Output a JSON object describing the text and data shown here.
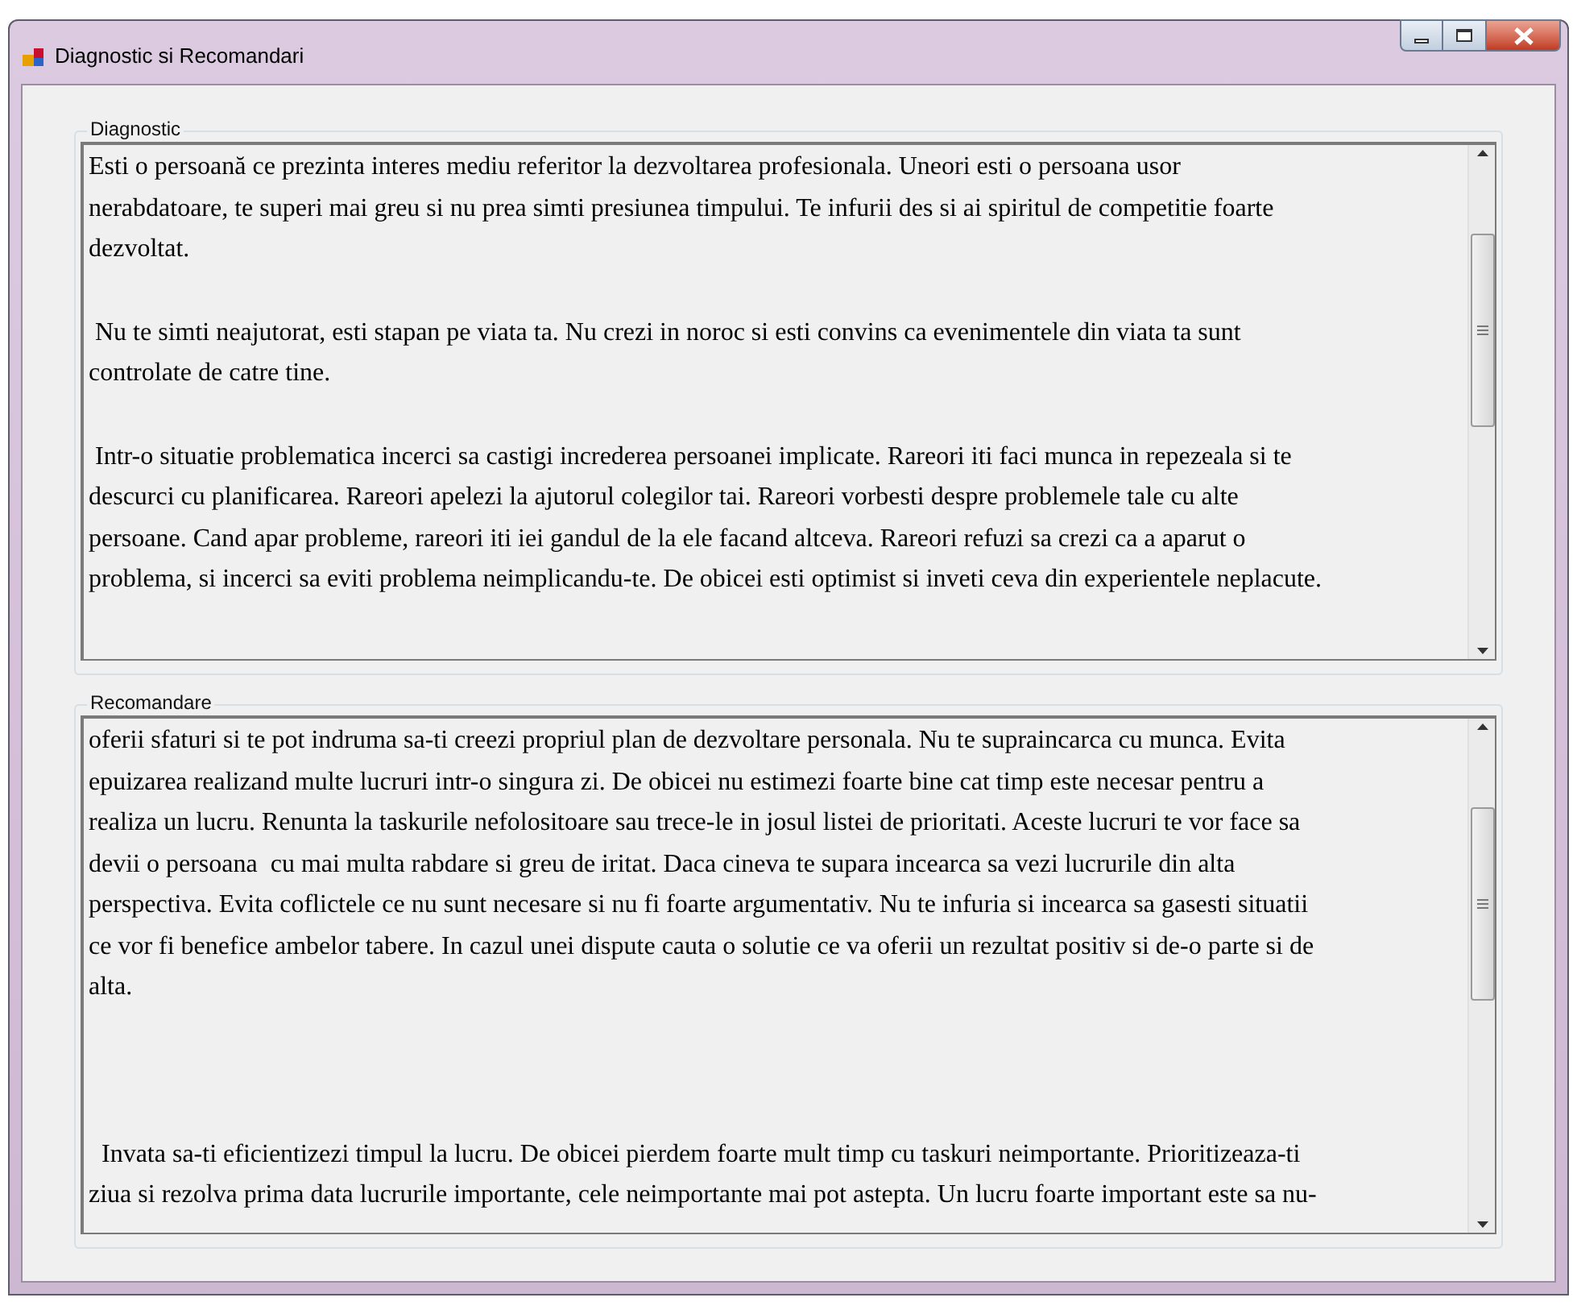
{
  "window": {
    "title": "Diagnostic si Recomandari",
    "controls": [
      {
        "kind": "minimize"
      },
      {
        "kind": "maximize"
      },
      {
        "kind": "close"
      }
    ]
  },
  "groups": [
    {
      "label": "Diagnostic",
      "paragraphs": [
        {
          "lines": [
            "Esti o persoană ce prezinta interes mediu referitor la dezvoltarea profesionala. Uneori esti o persoana usor",
            "nerabdatoare, te superi mai greu si nu prea simti presiunea timpului. Te infurii des si ai spiritul de competitie foarte",
            "dezvoltat."
          ]
        },
        {
          "lines": [
            " Nu te simti neajutorat, esti stapan pe viata ta. Nu crezi in noroc si esti convins ca evenimentele din viata ta sunt",
            "controlate de catre tine."
          ]
        },
        {
          "lines": [
            " Intr-o situatie problematica incerci sa castigi increderea persoanei implicate. Rareori iti faci munca in repezeala si te",
            "descurci cu planificarea. Rareori apelezi la ajutorul colegilor tai. Rareori vorbesti despre problemele tale cu alte",
            "persoane. Cand apar probleme, rareori iti iei gandul de la ele facand altceva. Rareori refuzi sa crezi ca a aparut o",
            "problema, si incerci sa eviti problema neimplicandu-te. De obicei esti optimist si inveti ceva din experientele neplacute."
          ]
        }
      ]
    },
    {
      "label": "Recomandare",
      "paragraphs": [
        {
          "lines": [
            "oferii sfaturi si te pot indruma sa-ti creezi propriul plan de dezvoltare personala. Nu te supraincarca cu munca. Evita",
            "epuizarea realizand multe lucruri intr-o singura zi. De obicei nu estimezi foarte bine cat timp este necesar pentru a",
            "realiza un lucru. Renunta la taskurile nefolositoare sau trece-le in josul listei de prioritati. Aceste lucruri te vor face sa",
            "devii o persoana  cu mai multa rabdare si greu de iritat. Daca cineva te supara incearca sa vezi lucrurile din alta",
            "perspectiva. Evita coflictele ce nu sunt necesare si nu fi foarte argumentativ. Nu te infuria si incearca sa gasesti situatii",
            "ce vor fi benefice ambelor tabere. In cazul unei dispute cauta o solutie ce va oferii un rezultat positiv si de-o parte si de",
            "alta."
          ]
        },
        {
          "lines": [
            "  Invata sa-ti eficientizezi timpul la lucru. De obicei pierdem foarte mult timp cu taskuri neimportante. Prioritizeaza-ti",
            "ziua si rezolva prima data lucrurile importante, cele neimportante mai pot astepta. Un lucru foarte important este sa nu-"
          ]
        }
      ]
    }
  ]
}
